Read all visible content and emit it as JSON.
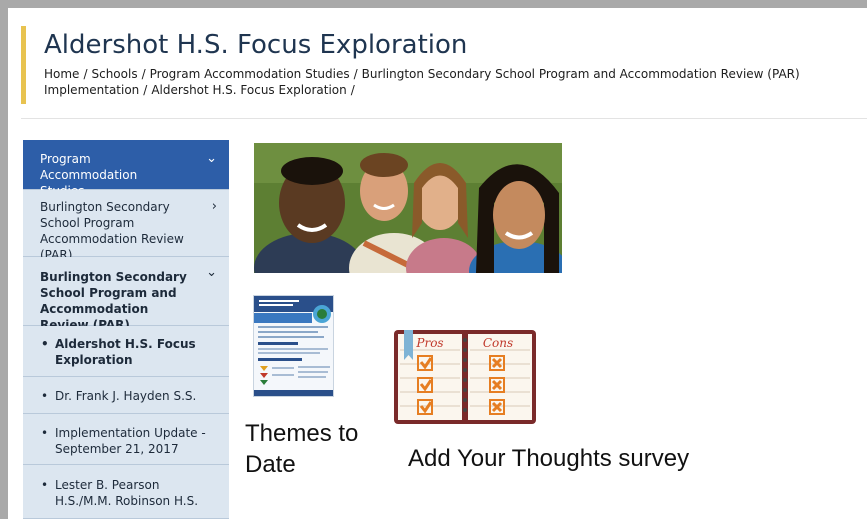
{
  "header": {
    "title": "Aldershot H.S. Focus Exploration",
    "breadcrumb": [
      "Home",
      "Schools",
      "Program Accommodation Studies",
      "Burlington Secondary School Program and Accommodation Review (PAR) Implementation",
      "Aldershot H.S. Focus Exploration"
    ],
    "breadcrumb_separator": "/"
  },
  "sidebar": {
    "items": [
      {
        "label": "Program Accommodation Studies",
        "icon": "chevron-down-icon",
        "active": true
      },
      {
        "label": "Burlington Secondary School Program Accommodation Review (PAR)",
        "icon": "chevron-right-icon"
      },
      {
        "label": "Burlington Secondary School Program and Accommodation Review (PAR) Implementation",
        "icon": "chevron-down-icon"
      }
    ],
    "subitems": [
      {
        "label": "Aldershot H.S. Focus Exploration",
        "current": true
      },
      {
        "label": "Dr. Frank J. Hayden S.S."
      },
      {
        "label": "Implementation Update - September 21, 2017"
      },
      {
        "label": "Lester B. Pearson H.S./M.M. Robinson H.S."
      }
    ],
    "bullet": "•",
    "chevron_down": "⌄",
    "chevron_right": "›"
  },
  "main": {
    "themes_caption": "Themes to Date",
    "thoughts_caption": "Add Your Thoughts survey",
    "proscons_image": {
      "pros_label": "Pros",
      "cons_label": "Cons"
    }
  },
  "colors": {
    "accent_bar": "#e8c350",
    "sidebar_active": "#2d5ea8",
    "sidebar_bg": "#dce6f0",
    "title": "#1f3550"
  }
}
